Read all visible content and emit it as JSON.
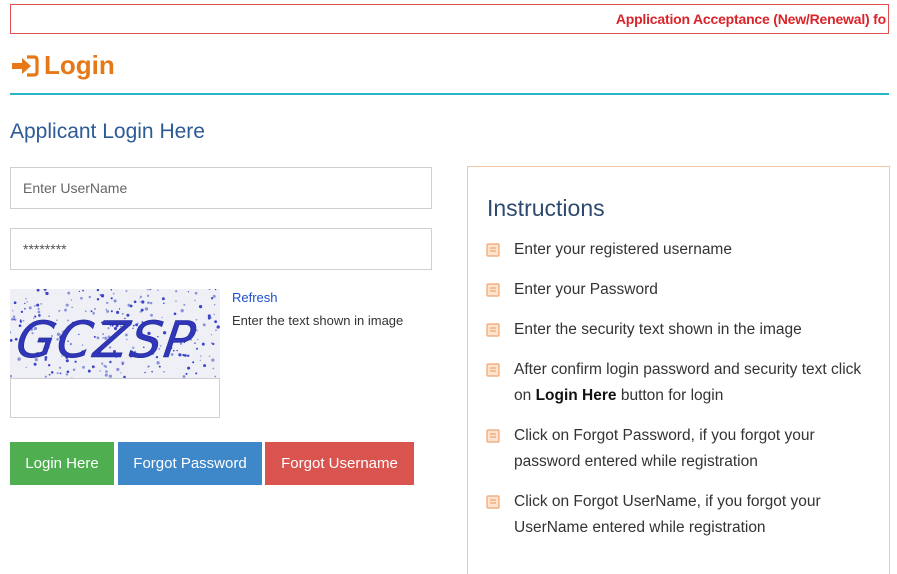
{
  "marquee": {
    "text": "Application Acceptance (New/Renewal) fo"
  },
  "header": {
    "title": "Login",
    "icon": "sign-in-icon",
    "accent_color": "#e67817",
    "rule_color": "#29b6c8"
  },
  "form": {
    "heading": "Applicant Login Here",
    "username_placeholder": "Enter UserName",
    "password_value": "********",
    "captcha": {
      "text": "GCZSP",
      "refresh_label": "Refresh",
      "hint": "Enter the text shown in image"
    },
    "captcha_input_value": ""
  },
  "buttons": {
    "login": "Login Here",
    "forgot_password": "Forgot Password",
    "forgot_username": "Forgot Username"
  },
  "instructions": {
    "title": "Instructions",
    "items": [
      {
        "pre": "Enter your registered username",
        "bold": "",
        "post": ""
      },
      {
        "pre": "Enter your Password",
        "bold": "",
        "post": ""
      },
      {
        "pre": "Enter the security text shown in the image",
        "bold": "",
        "post": ""
      },
      {
        "pre": "After confirm login password and security text click on ",
        "bold": "Login Here",
        "post": " button for login"
      },
      {
        "pre": "Click on Forgot Password, if you forgot your password entered while registration",
        "bold": "",
        "post": ""
      },
      {
        "pre": "Click on Forgot UserName, if you forgot your UserName entered while registration",
        "bold": "",
        "post": ""
      }
    ]
  },
  "colors": {
    "login_button": "#4fae4f",
    "forgot_password_button": "#3e87c9",
    "forgot_username_button": "#d9534f",
    "marquee_text": "#d9242a",
    "heading_blue": "#2d5b96"
  }
}
